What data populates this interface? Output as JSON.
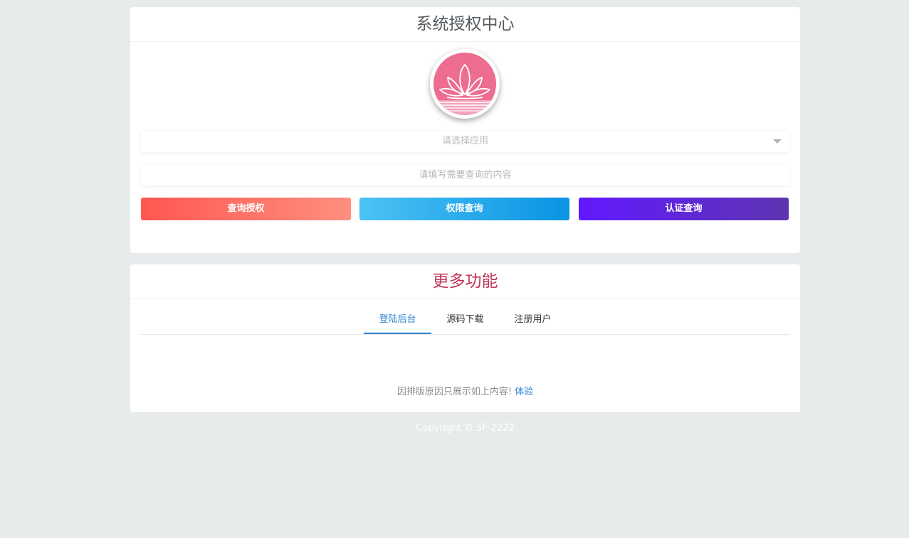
{
  "auth_card": {
    "title": "系统授权中心",
    "select": {
      "placeholder": "请选择应用"
    },
    "query_input": {
      "placeholder": "请填写需要查询的内容",
      "value": ""
    },
    "buttons": {
      "query_auth": "查询授权",
      "permission_query": "权限查询",
      "certification_query": "认证查询"
    },
    "logo_icon": "lotus-icon"
  },
  "more_card": {
    "title": "更多功能",
    "tabs": [
      {
        "label": "登陆后台",
        "active": true
      },
      {
        "label": "源码下载",
        "active": false
      },
      {
        "label": "注册用户",
        "active": false
      }
    ],
    "notice_text": "因排版原因只展示如上内容!",
    "notice_link": "体验"
  },
  "footer": {
    "copyright": "Copyright © SF-2222"
  },
  "colors": {
    "background": "#e8ebec",
    "more_title": "#c2355a",
    "tab_active": "#2f83d1",
    "logo_pink": "#ec6d90"
  }
}
